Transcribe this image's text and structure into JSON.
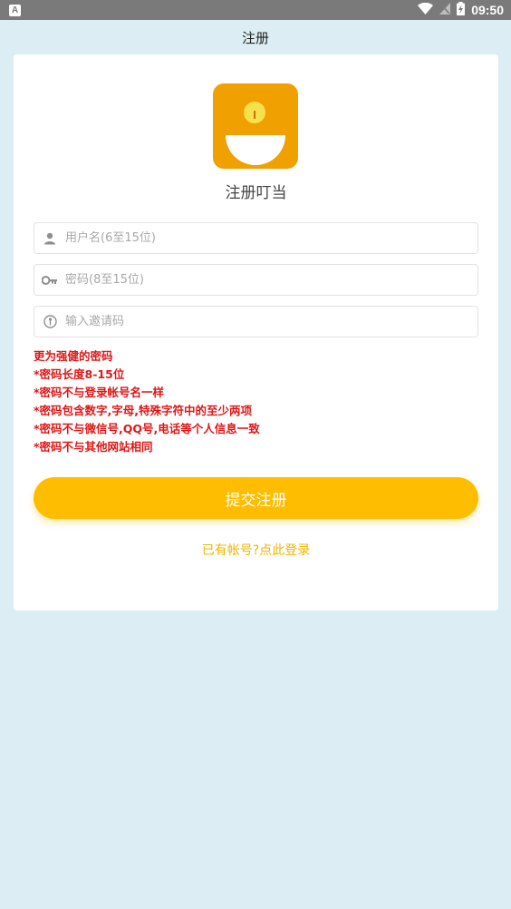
{
  "status_bar": {
    "app_icon_letter": "A",
    "time": "09:50",
    "icons": [
      "wifi-icon",
      "signal-off-icon",
      "battery-charging-icon"
    ]
  },
  "header": {
    "title": "注册"
  },
  "app": {
    "name": "注册叮当",
    "logo_colors": {
      "background": "#f0a000",
      "dot": "#f8e04a",
      "bowl": "#ffffff"
    }
  },
  "form": {
    "username": {
      "value": "",
      "placeholder": "用户名(6至15位)",
      "icon": "person-icon"
    },
    "password": {
      "value": "",
      "placeholder": "密码(8至15位)",
      "icon": "key-icon"
    },
    "invite": {
      "value": "",
      "placeholder": "输入邀请码",
      "icon": "info-circle-icon"
    }
  },
  "hints": [
    "更为强健的密码",
    "*密码长度8-15位",
    "*密码不与登录帐号名一样",
    "*密码包含数字,字母,特殊字符中的至少两项",
    "*密码不与微信号,QQ号,电话等个人信息一致",
    "*密码不与其他网站相同"
  ],
  "actions": {
    "submit_label": "提交注册",
    "login_link": "已有帐号?点此登录"
  },
  "colors": {
    "background": "#dceef3",
    "accent": "#ffbd00",
    "link": "#f0b400",
    "hint": "#e01616"
  }
}
